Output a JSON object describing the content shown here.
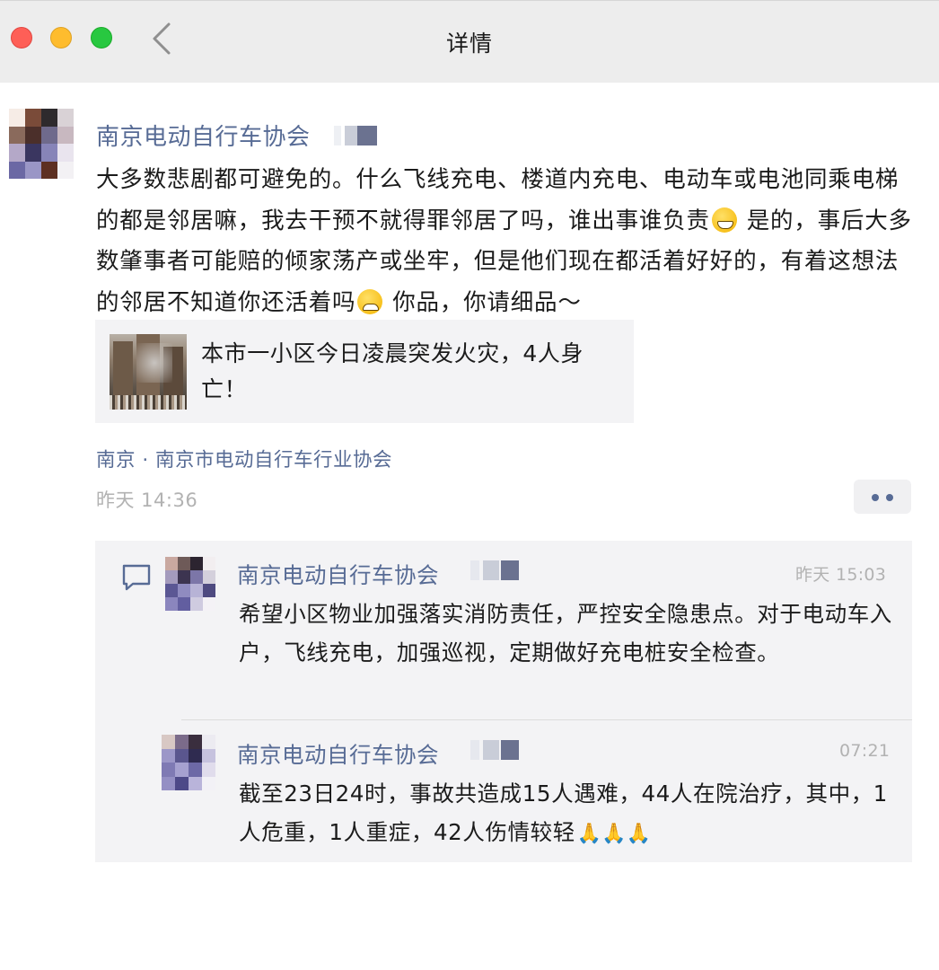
{
  "window": {
    "title": "详情",
    "controls": [
      "close",
      "minimize",
      "maximize"
    ]
  },
  "moment": {
    "author": "南京电动自行车协会",
    "text_part1": "大多数悲剧都可避免的。什么飞线充电、楼道内充电、电动车或电池同乘电梯的都是邻居嘛，我去干预不就得罪邻居了吗，谁出事谁负责",
    "text_part2": " 是的，事后大多数肇事者可能赔的倾家荡产或坐牢，但是他们现在都活着好好的，有着这想法的邻居不知道你还活着吗",
    "text_part3": " 你品，你请细品～",
    "link": {
      "title": "本市一小区今日凌晨突发火灾，4人身亡！"
    },
    "location": "南京 · 南京市电动自行车行业协会",
    "time": "昨天 14:36"
  },
  "comments": [
    {
      "author": "南京电动自行车协会",
      "time": "昨天 15:03",
      "text": "希望小区物业加强落实消防责任，严控安全隐患点。对于电动车入户，飞线充电，加强巡视，定期做好充电桩安全检查。"
    },
    {
      "author": "南京电动自行车协会",
      "time": "07:21",
      "text": "截至23日24时，事故共造成15人遇难，44人在院治疗，其中，1人危重，1人重症，42人伤情较轻",
      "emoji": "🙏🙏🙏"
    }
  ],
  "colors": {
    "link_blue": "#576b95",
    "text": "#1b1b1b",
    "meta_gray": "#b2b2b2",
    "card_bg": "#f3f3f5",
    "titlebar_bg": "#ededed"
  },
  "icons": {
    "back": "chevron-left-icon",
    "comment": "comment-bubble-icon",
    "more": "more-dots-icon"
  }
}
